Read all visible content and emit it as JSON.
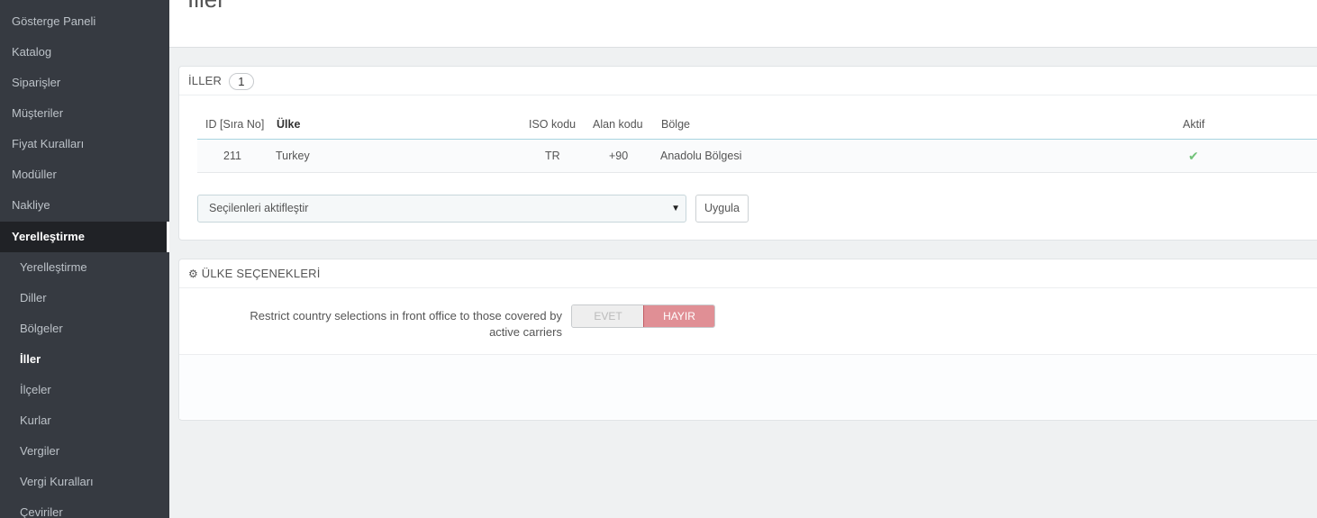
{
  "sidebar": {
    "items": [
      {
        "label": "Gösterge Paneli"
      },
      {
        "label": "Katalog"
      },
      {
        "label": "Siparişler"
      },
      {
        "label": "Müşteriler"
      },
      {
        "label": "Fiyat Kuralları"
      },
      {
        "label": "Modüller"
      },
      {
        "label": "Nakliye"
      },
      {
        "label": "Yerelleştirme"
      }
    ],
    "sub_items": [
      {
        "label": "Yerelleştirme"
      },
      {
        "label": "Diller"
      },
      {
        "label": "Bölgeler"
      },
      {
        "label": "İller"
      },
      {
        "label": "İlçeler"
      },
      {
        "label": "Kurlar"
      },
      {
        "label": "Vergiler"
      },
      {
        "label": "Vergi Kuralları"
      },
      {
        "label": "Çeviriler"
      }
    ]
  },
  "header": {
    "title": "İller"
  },
  "list_panel": {
    "title": "İLLER",
    "count": "1",
    "columns": {
      "id": "ID [Sıra No]",
      "country": "Ülke",
      "iso": "ISO kodu",
      "call_prefix": "Alan kodu",
      "zone": "Bölge",
      "active": "Aktif"
    },
    "rows": [
      {
        "id": "211",
        "country": "Turkey",
        "iso": "TR",
        "call_prefix": "+90",
        "zone": "Anadolu Bölgesi",
        "active": "✔"
      }
    ],
    "bulk_action": "Seçilenleri aktifleştir",
    "apply_label": "Uygula"
  },
  "options_panel": {
    "title": "ÜLKE SEÇENEKLERİ",
    "restrict_label_line1": "Restrict country selections in front office to those covered by",
    "restrict_label_line2": "active carriers",
    "switch_yes": "EVET",
    "switch_no": "HAYIR"
  },
  "colors": {
    "sidebar": "#363a41",
    "active": "#202226",
    "no_switch": "#e08f95",
    "check": "#72c279"
  }
}
